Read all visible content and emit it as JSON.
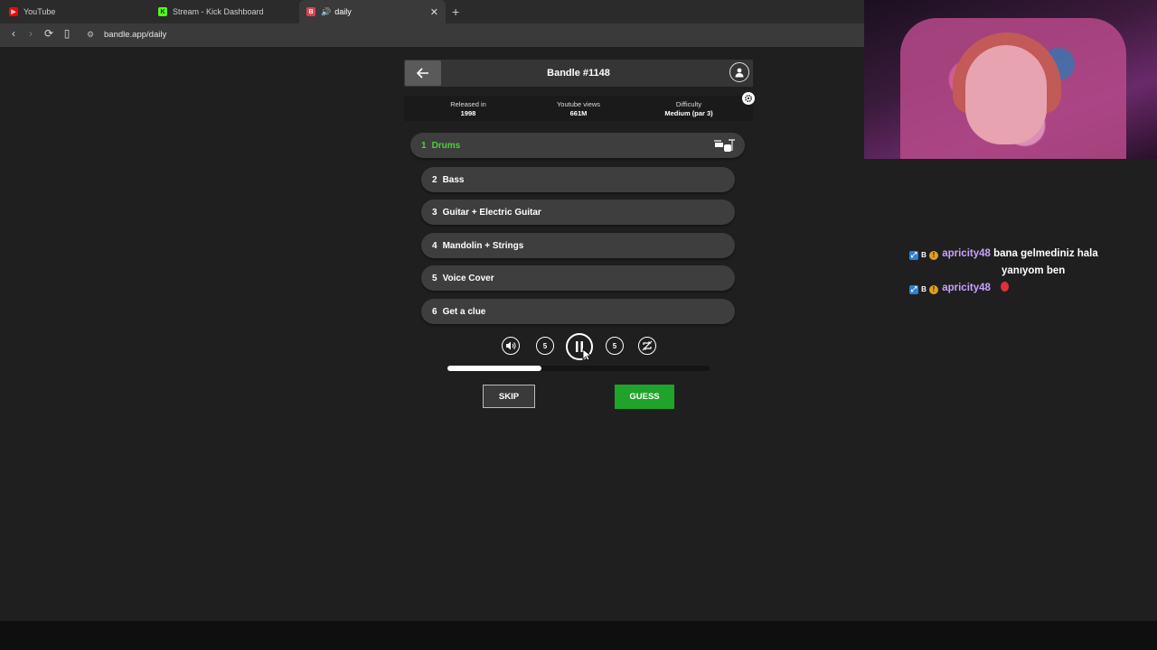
{
  "browser": {
    "tabs": [
      {
        "title": "YouTube",
        "fav": "youtube-icon",
        "color": "#ff0000"
      },
      {
        "title": "Stream - Kick Dashboard",
        "fav": "kick-icon",
        "color": "#53fc18"
      },
      {
        "title": "daily",
        "fav": "bandle-icon",
        "color": "#e04050"
      }
    ],
    "new_tab": "+",
    "close": "✕",
    "url": "bandle.app/daily"
  },
  "game": {
    "title": "Bandle #1148",
    "info": [
      {
        "label": "Released in",
        "value": "1998"
      },
      {
        "label": "Youtube views",
        "value": "661M"
      },
      {
        "label": "Difficulty",
        "value": "Medium (par 3)"
      }
    ],
    "clues": [
      {
        "num": "1",
        "label": "Drums"
      },
      {
        "num": "2",
        "label": "Bass"
      },
      {
        "num": "3",
        "label": "Guitar + Electric Guitar"
      },
      {
        "num": "4",
        "label": "Mandolin + Strings"
      },
      {
        "num": "5",
        "label": "Voice Cover"
      },
      {
        "num": "6",
        "label": "Get a clue"
      }
    ],
    "controls": {
      "rewind_label": "5",
      "forward_label": "5"
    },
    "progress": 0.36,
    "skip_label": "SKIP",
    "guess_label": "GUESS",
    "accent": "#4cd137",
    "guess_color": "#1fa32a"
  },
  "chat": {
    "messages": [
      {
        "user": "apricity48",
        "text": "bana gelmediniz hala",
        "text2": "yanıyom ben"
      },
      {
        "user": "apricity48",
        "text": ""
      }
    ],
    "badge_b": "B",
    "badge_coin": "!"
  }
}
